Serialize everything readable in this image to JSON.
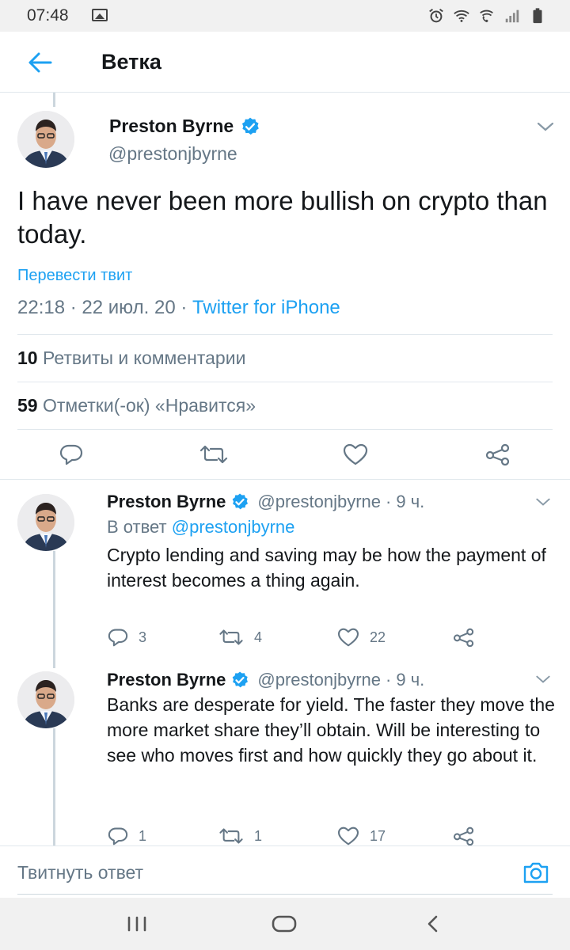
{
  "status_bar": {
    "time": "07:48",
    "icons": [
      "image-icon",
      "alarm-icon",
      "wifi-icon",
      "wifi-call-icon",
      "signal-icon",
      "battery-icon"
    ]
  },
  "header": {
    "back_icon": "arrow-left-icon",
    "title": "Ветка"
  },
  "main_tweet": {
    "author_name": "Preston Byrne",
    "handle": "@prestonjbyrne",
    "verified": true,
    "text": "I have never been more bullish on crypto than today.",
    "translate_label": "Перевести твит",
    "time": "22:18",
    "date": "22 июл. 20",
    "source": "Twitter for iPhone",
    "retweets_count": "10",
    "retweets_label": "Ретвиты и комментарии",
    "likes_count": "59",
    "likes_label": "Отметки(-ок) «Нравится»",
    "actions": [
      "reply-icon",
      "retweet-icon",
      "like-icon",
      "share-icon"
    ]
  },
  "replies": [
    {
      "author_name": "Preston Byrne",
      "handle": "@prestonjbyrne",
      "age": "9 ч.",
      "reply_to_prefix": "В ответ",
      "reply_to_handle": "@prestonjbyrne",
      "text": "Crypto lending and saving may be how the payment of interest becomes a thing again.",
      "reply_count": "3",
      "retweet_count": "4",
      "like_count": "22"
    },
    {
      "author_name": "Preston Byrne",
      "handle": "@prestonjbyrne",
      "age": "9 ч.",
      "text": "Banks are desperate for yield. The faster they move the more market share they’ll obtain. Will be interesting to see who moves first and how quickly they go about it.",
      "reply_count": "1",
      "retweet_count": "1",
      "like_count": "17"
    }
  ],
  "composer": {
    "placeholder": "Твитнуть ответ",
    "camera_icon": "camera-icon"
  },
  "nav_bar": {
    "buttons": [
      "recent-apps-icon",
      "home-icon",
      "back-icon"
    ]
  },
  "colors": {
    "accent": "#1da1f2",
    "secondary_text": "#657786",
    "divider": "#e1e8ed"
  }
}
